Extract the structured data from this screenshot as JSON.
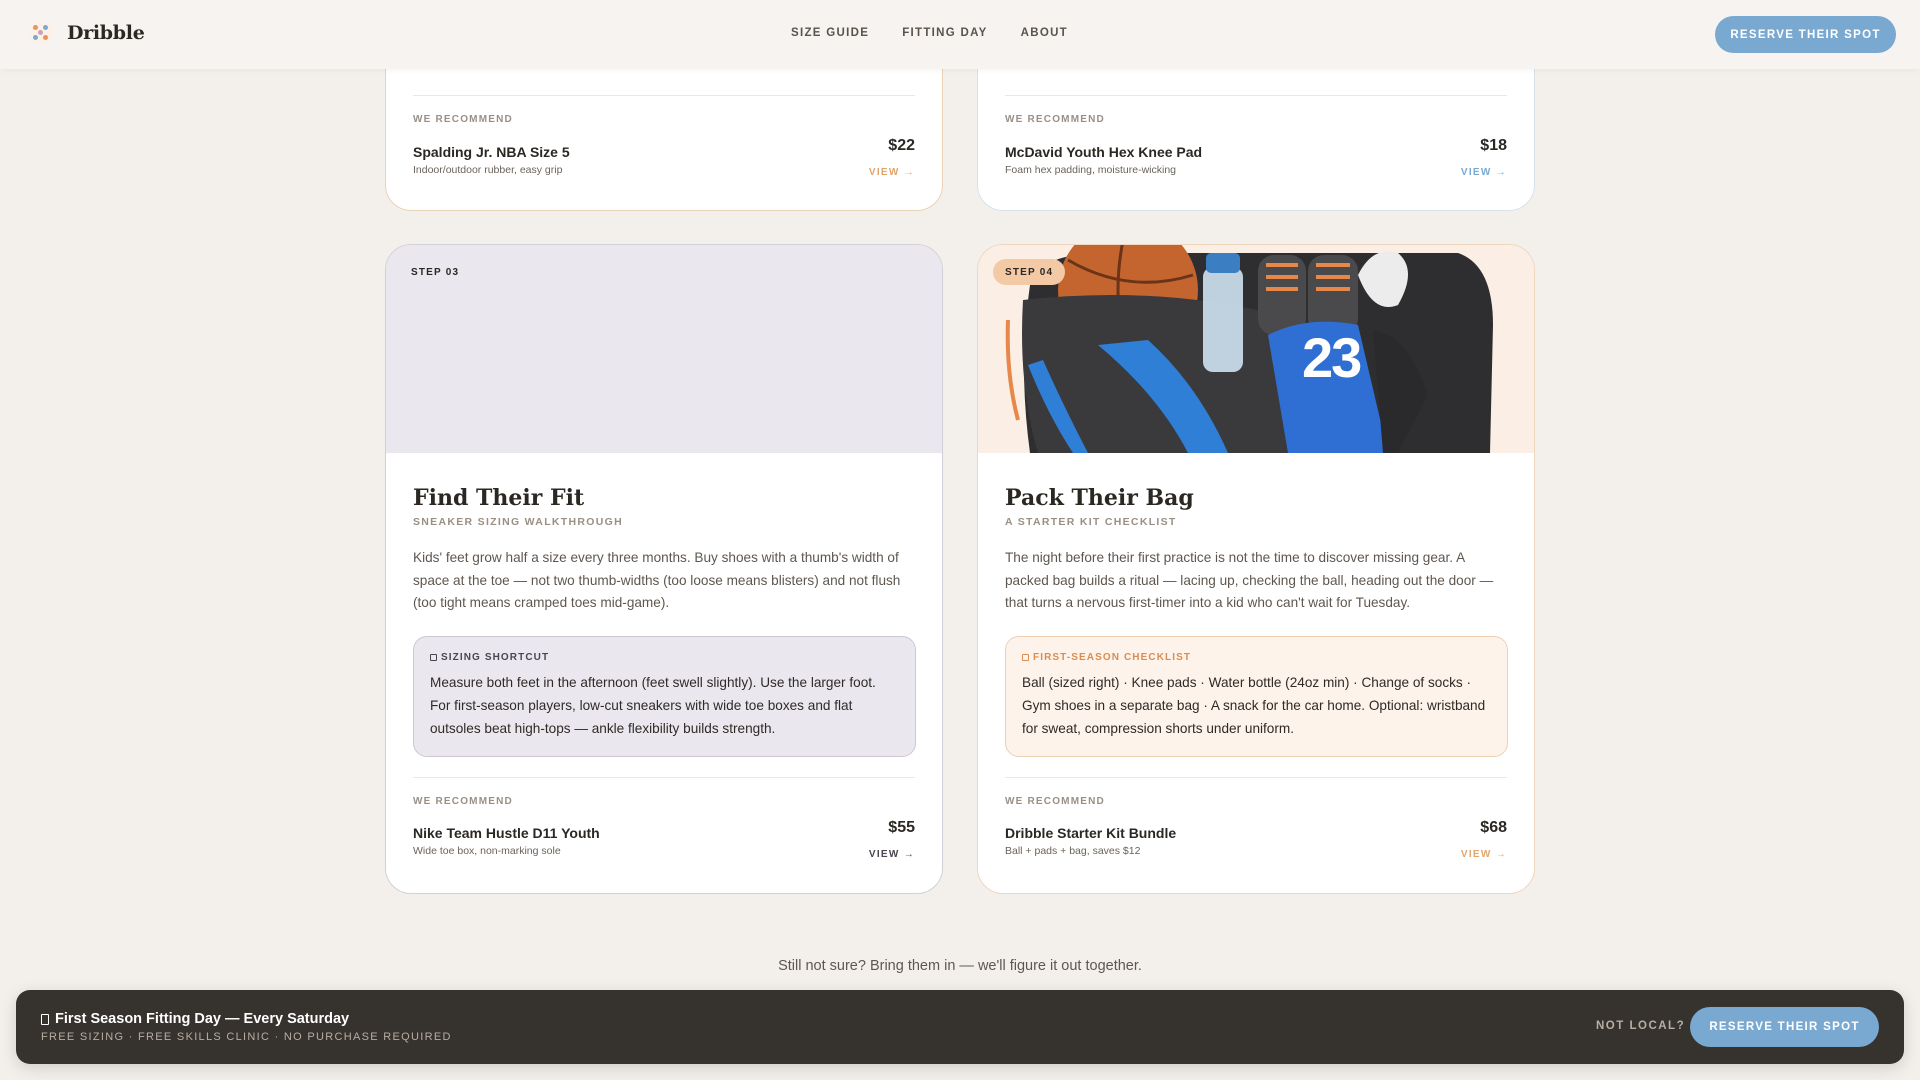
{
  "header": {
    "brand": "Dribble",
    "nav": [
      "SIZE GUIDE",
      "FITTING DAY",
      "ABOUT"
    ],
    "cta": "RESERVE THEIR SPOT"
  },
  "cards_top": [
    {
      "rec_label": "WE RECOMMEND",
      "rec_name": "Spalding Jr. NBA Size 5",
      "rec_desc": "Indoor/outdoor rubber, easy grip",
      "rec_price": "$22",
      "rec_view": "VIEW →"
    },
    {
      "rec_label": "WE RECOMMEND",
      "rec_name": "McDavid Youth Hex Knee Pad",
      "rec_desc": "Foam hex padding, moisture-wicking",
      "rec_price": "$18",
      "rec_view": "VIEW →"
    }
  ],
  "cards": [
    {
      "step": "STEP 03",
      "title": "Find Their Fit",
      "subtitle": "SNEAKER SIZING WALKTHROUGH",
      "body": "Kids' feet grow half a size every three months. Buy shoes with a thumb's width of space at the toe — not two thumb-widths (too loose means blisters) and not flush (too tight means cramped toes mid-game).",
      "tip_label": "SIZING SHORTCUT",
      "tip_text": "Measure both feet in the afternoon (feet swell slightly). Use the larger foot. For first-season players, low-cut sneakers with wide toe boxes and flat outsoles beat high-tops — ankle flexibility builds strength.",
      "rec_label": "WE RECOMMEND",
      "rec_name": "Nike Team Hustle D11 Youth",
      "rec_desc": "Wide toe box, non-marking sole",
      "rec_price": "$55",
      "rec_view": "VIEW →"
    },
    {
      "step": "STEP 04",
      "title": "Pack Their Bag",
      "subtitle": "A STARTER KIT CHECKLIST",
      "body": "The night before their first practice is not the time to discover missing gear. A packed bag builds a ritual — lacing up, checking the ball, heading out the door — that turns a nervous first-timer into a kid who can't wait for Tuesday.",
      "tip_label": "FIRST-SEASON CHECKLIST",
      "tip_text": "Ball (sized right) · Knee pads · Water bottle (24oz min) · Change of socks · Gym shoes in a separate bag · A snack for the car home. Optional: wristband for sweat, compression shorts under uniform.",
      "rec_label": "WE RECOMMEND",
      "rec_name": "Dribble Starter Kit Bundle",
      "rec_desc": "Ball + pads + bag, saves $12",
      "rec_price": "$68",
      "rec_view": "VIEW →",
      "jersey_number": "23"
    }
  ],
  "tagline": "Still not sure? Bring them in — we'll figure it out together.",
  "bottom_bar": {
    "title": "First Season Fitting Day — Every Saturday",
    "subtitle": "FREE SIZING · FREE SKILLS CLINIC · NO PURCHASE REQUIRED",
    "not_local": "NOT LOCAL?",
    "cta": "RESERVE THEIR SPOT"
  },
  "colors": {
    "accent_blue": "#79a9d1",
    "accent_orange": "#e0a56e",
    "purple_tint": "#ebe7ef",
    "peach_tint": "#fdf3ea",
    "dark_bar": "#36322e"
  }
}
